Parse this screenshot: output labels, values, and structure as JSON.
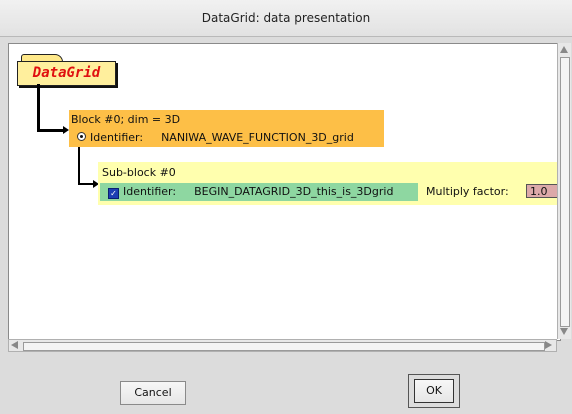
{
  "window": {
    "title": "DataGrid: data presentation"
  },
  "tree": {
    "root_label": "DataGrid",
    "block": {
      "header": "Block #0;   dim = 3D",
      "identifier_label": "Identifier:",
      "identifier_value": "NANIWA_WAVE_FUNCTION_3D_grid"
    },
    "subblock": {
      "header": "Sub-block #0",
      "identifier_label": "Identifier:",
      "identifier_value": "BEGIN_DATAGRID_3D_this_is_3Dgrid",
      "multiply_label": "Multiply factor:",
      "multiply_value": "1.0"
    }
  },
  "buttons": {
    "cancel": "Cancel",
    "ok": "OK"
  },
  "colors": {
    "block": "#fdbf47",
    "subblock": "#ffffae",
    "identifier": "#8ed7a1",
    "root_text": "#e01010"
  }
}
